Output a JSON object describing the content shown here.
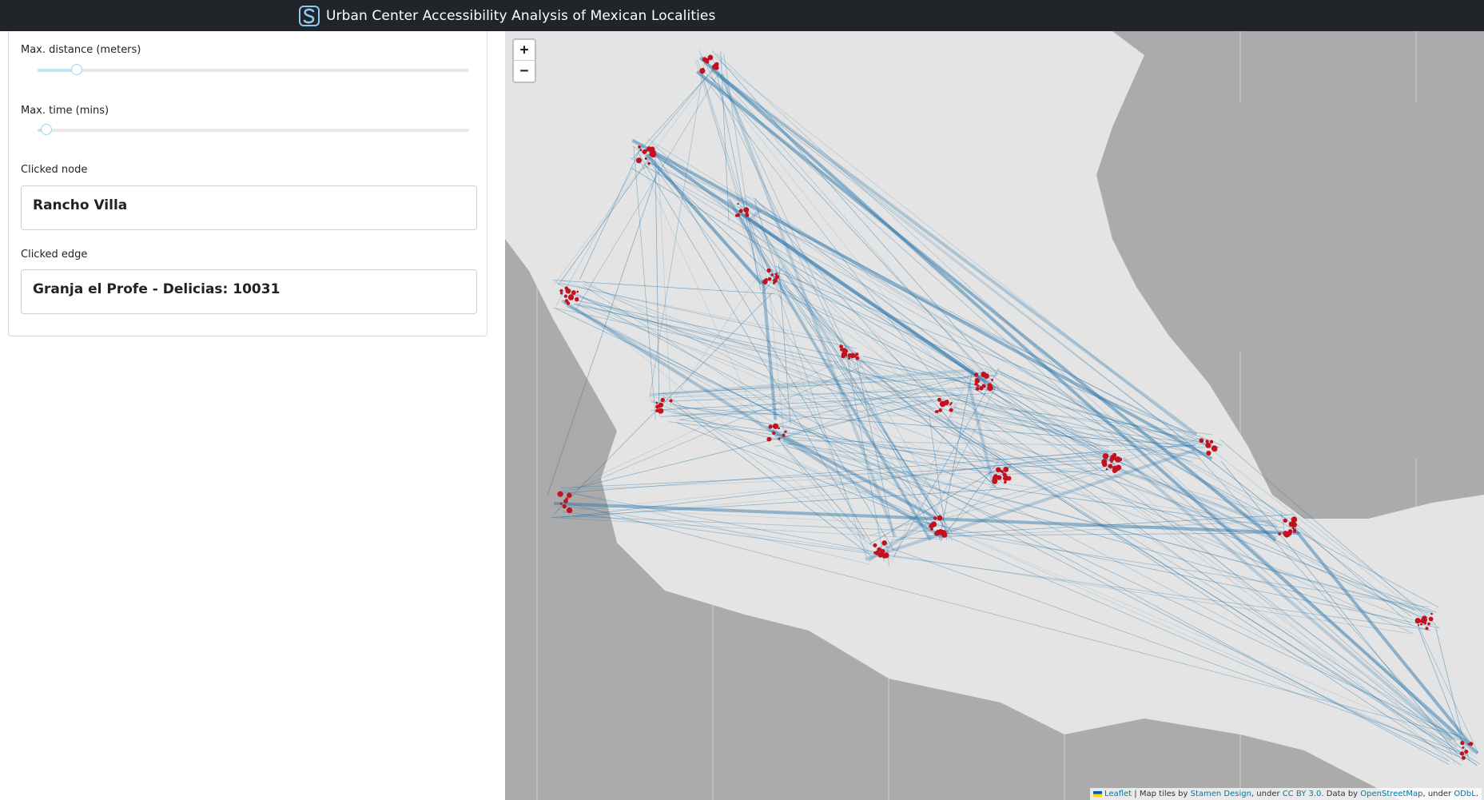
{
  "app": {
    "title": "Urban Center Accessibility Analysis of Mexican Localities"
  },
  "controls": {
    "max_distance": {
      "label": "Max. distance (meters)",
      "value_fraction": 0.09
    },
    "max_time": {
      "label": "Max. time (mins)",
      "value_fraction": 0.02
    },
    "clicked_node": {
      "label": "Clicked node",
      "value": "Rancho Villa"
    },
    "clicked_edge": {
      "label": "Clicked edge",
      "value": "Granja el Profe - Delicias: 10031"
    }
  },
  "map": {
    "zoom_in": "+",
    "zoom_out": "−",
    "colors": {
      "edge": "#2171a8",
      "node": "#c1121f",
      "land": "#e4e4e4",
      "water": "#ababab"
    },
    "attribution": {
      "leaflet": "Leaflet",
      "sep1": " | Map tiles by ",
      "stamen": "Stamen Design",
      "sep2": ", under ",
      "ccby": "CC BY 3.0",
      "sep3": ". Data by ",
      "osm": "OpenStreetMap",
      "sep4": ", under ",
      "odbl": "ODbL",
      "end": "."
    }
  }
}
